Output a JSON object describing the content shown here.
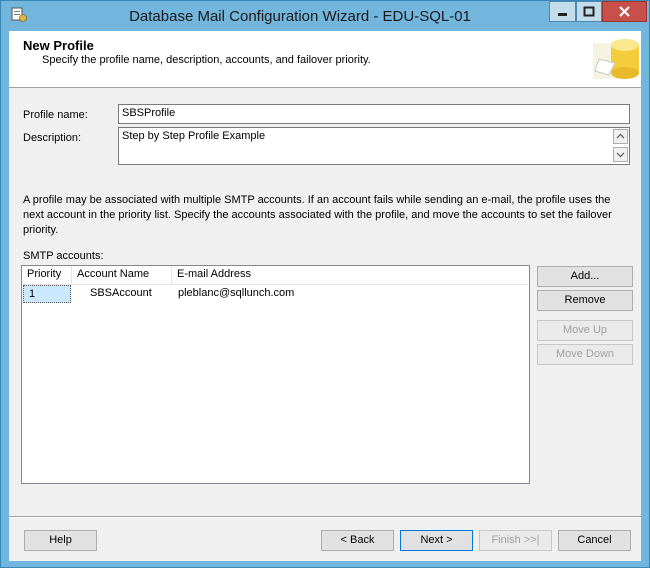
{
  "window": {
    "title": "Database Mail Configuration Wizard - EDU-SQL-01"
  },
  "header": {
    "title": "New Profile",
    "subtitle": "Specify the profile name, description, accounts, and failover priority."
  },
  "form": {
    "profile_name_label": "Profile name:",
    "profile_name_value": "SBSProfile",
    "description_label": "Description:",
    "description_value": "Step by Step Profile Example"
  },
  "info_text": "A profile may be associated with multiple SMTP accounts. If an account fails while sending an e-mail, the profile uses the next account in the priority list. Specify the accounts associated with the profile, and move the accounts to set the failover priority.",
  "smtp": {
    "label": "SMTP accounts:",
    "columns": [
      "Priority",
      "Account Name",
      "E-mail Address"
    ],
    "rows": [
      {
        "priority": "1",
        "account": "SBSAccount",
        "email": "pleblanc@sqllunch.com"
      }
    ]
  },
  "side_buttons": {
    "add": "Add...",
    "remove": "Remove",
    "move_up": "Move Up",
    "move_down": "Move Down"
  },
  "footer": {
    "help": "Help",
    "back": "< Back",
    "next": "Next >",
    "finish": "Finish >>|",
    "cancel": "Cancel"
  }
}
